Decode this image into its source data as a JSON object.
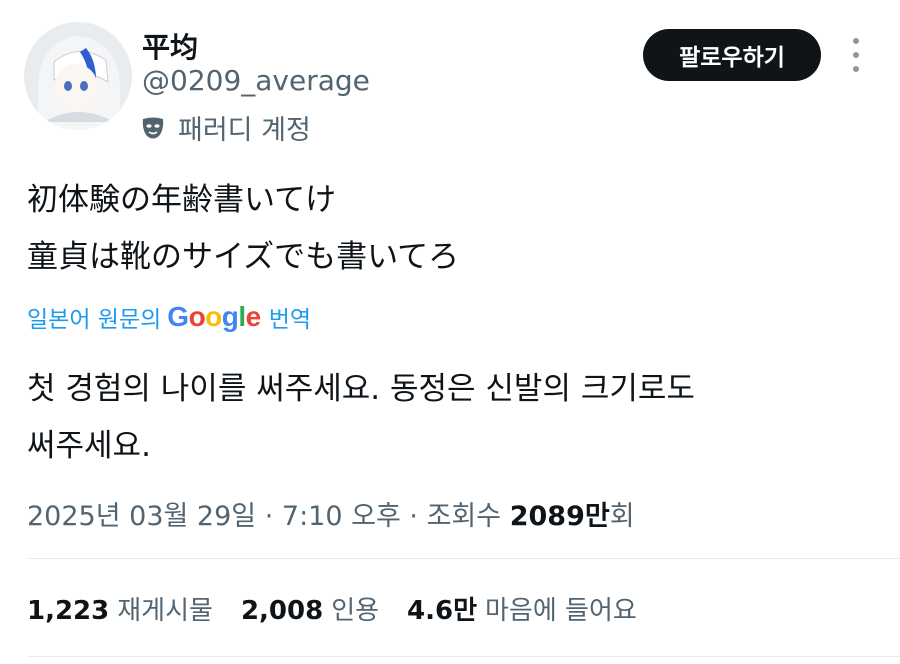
{
  "profile": {
    "display_name": "平均",
    "handle": "@0209_average",
    "badge_label": "패러디 계정"
  },
  "follow_button": "팔로우하기",
  "tweet": {
    "lines": [
      "初体験の年齢書いてけ",
      "童貞は靴のサイズでも書いてろ"
    ]
  },
  "translation": {
    "prefix": "일본어 원문의",
    "google": [
      "G",
      "o",
      "o",
      "g",
      "l",
      "e"
    ],
    "suffix": "번역",
    "lines": [
      "첫 경험의 나이를 써주세요. 동정은 신발의 크기로도",
      "써주세요."
    ]
  },
  "meta": {
    "date": "2025년 03월 29일",
    "sep": "·",
    "time": "7:10 오후",
    "views_label": "조회수",
    "views_num": "2089만",
    "views_suffix": "회"
  },
  "stats": {
    "retweets": {
      "num": "1,223",
      "label": "재게시물"
    },
    "quotes": {
      "num": "2,008",
      "label": "인용"
    },
    "likes": {
      "num": "4.6만",
      "label": "마음에 들어요"
    }
  },
  "colors": {
    "accent": "#1d9bf0",
    "text": "#0f1419",
    "muted": "#536471"
  }
}
